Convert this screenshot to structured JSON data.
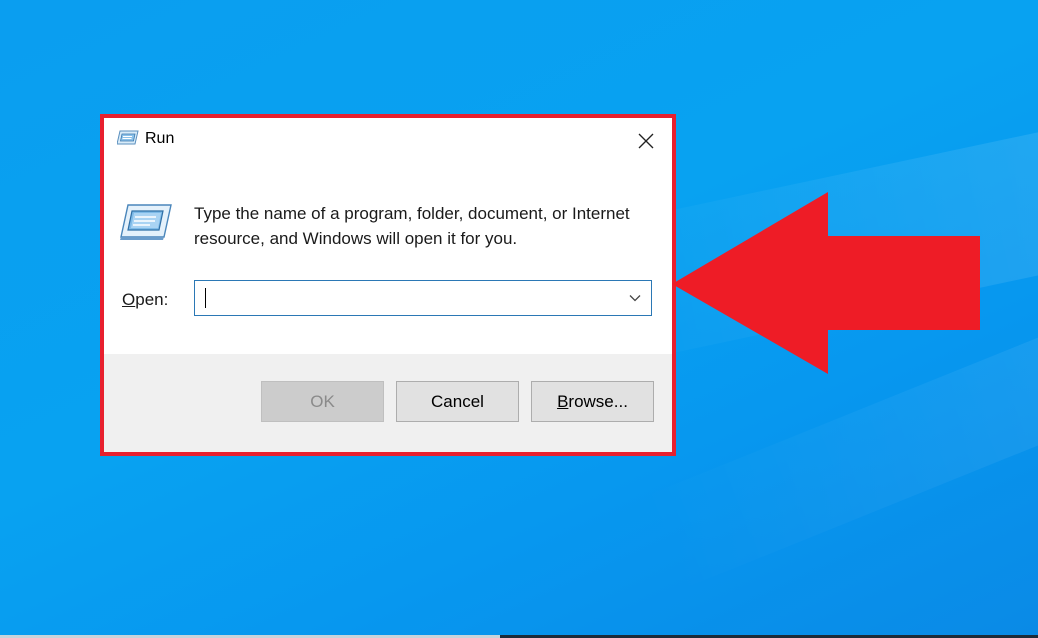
{
  "dialog": {
    "title": "Run",
    "instruction": "Type the name of a program, folder, document, or Internet resource, and Windows will open it for you.",
    "open_label_mnemonic": "O",
    "open_label_rest": "pen:",
    "open_value": "",
    "buttons": {
      "ok": "OK",
      "cancel": "Cancel",
      "browse_mnemonic": "B",
      "browse_rest": "rowse..."
    },
    "icons": {
      "title_icon": "run-app-icon",
      "big_icon": "run-app-icon",
      "close": "close-icon",
      "dropdown": "chevron-down-icon"
    }
  },
  "annotation": {
    "frame_color": "#e8202e",
    "arrow_color": "#ee1c26",
    "arrow_icon": "left-arrow-icon"
  },
  "desktop": {
    "background_color": "#0a9ef0"
  }
}
